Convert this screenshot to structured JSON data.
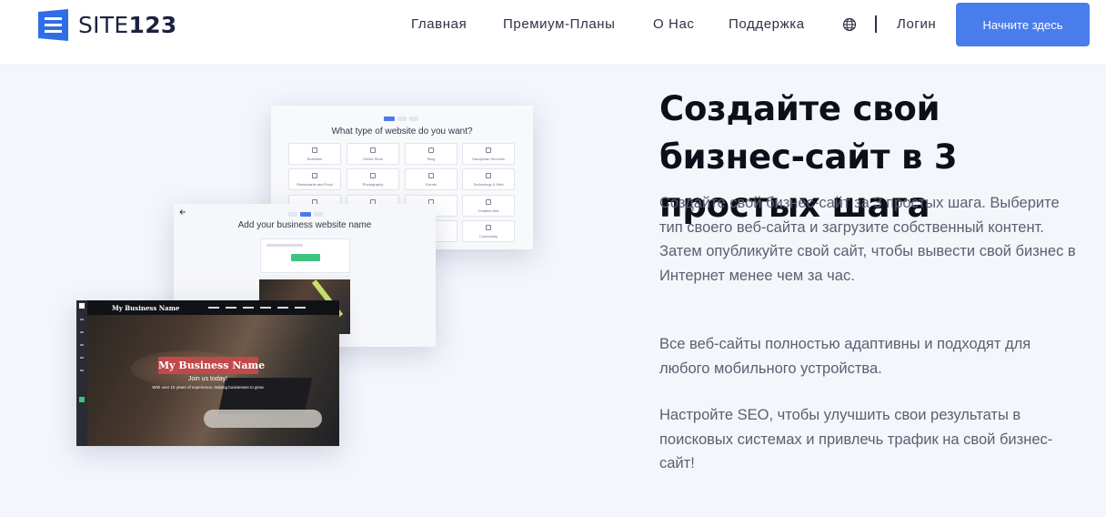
{
  "header": {
    "logo_prefix": "SITE",
    "logo_number": "123",
    "nav": [
      "Главная",
      "Премиум-Планы",
      "О Нас",
      "Поддержка"
    ],
    "login": "Логин",
    "cta": "Начните здесь",
    "icons": {
      "logo": "site123-logo-icon",
      "language": "globe-icon"
    }
  },
  "hero": {
    "title": "Создайте свой бизнес-сайт в 3 простых шага",
    "paragraphs": [
      "Создайте свой бизнес-сайт за 3 простых шага. Выберите тип своего веб-сайта и загрузите собственный контент. Затем опубликуйте свой сайт, чтобы вывести свой бизнес в Интернет менее чем за час.",
      "Все веб-сайты полностью адаптивны и подходят для любого мобильного устройства.",
      "Настройте SEO, чтобы улучшить свои результаты в поисковых системах и привлечь трафик на свой бизнес-сайт!"
    ]
  },
  "mockups": {
    "step1_title": "What type of website do you want?",
    "step1_cards": [
      "Business",
      "Online Store",
      "Blog",
      "Handyman Services",
      "Restaurants and Food",
      "Photography",
      "Events",
      "Technology & Web",
      "",
      "",
      "",
      "Creative Arts",
      "",
      "",
      "",
      "Community"
    ],
    "step2_title": "Add your business website name",
    "step3_brand": "My Business Name",
    "step3_name": "My Business Name",
    "step3_join": "Join us today!",
    "step3_text": "With over 15 years of experience, helping businesses to grow"
  },
  "colors": {
    "accent": "#4a7dec",
    "name_badge": "#c04a4a",
    "green_button": "#3fc380"
  }
}
